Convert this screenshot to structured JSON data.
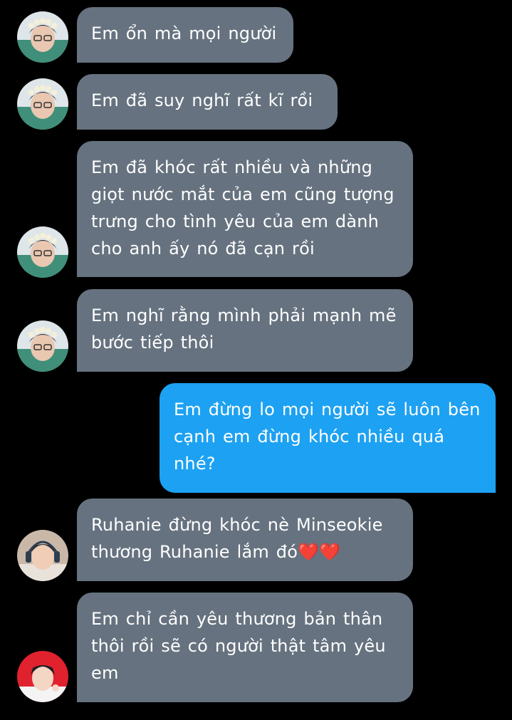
{
  "colors": {
    "background": "#000000",
    "incoming_bubble": "#66727f",
    "outgoing_bubble": "#1da1f2",
    "text": "#ffffff"
  },
  "messages": [
    {
      "sender": "incoming",
      "avatar": "avatar-flower-crown",
      "text": "Em ổn mà mọi người"
    },
    {
      "sender": "incoming",
      "avatar": "avatar-flower-crown",
      "text": "Em đã suy nghĩ rất kĩ rồi"
    },
    {
      "sender": "incoming",
      "avatar": "avatar-flower-crown",
      "text": "Em đã khóc rất nhiều và những giọt nước mắt của em cũng tượng trưng cho tình yêu của em dành cho anh ấy nó đã cạn rồi"
    },
    {
      "sender": "incoming",
      "avatar": "avatar-flower-crown",
      "text": "Em nghĩ rằng mình phải mạnh mẽ bước tiếp thôi"
    },
    {
      "sender": "outgoing",
      "text": "Em đừng lo mọi người sẽ luôn bên cạnh em đừng khóc nhiều quá nhé?"
    },
    {
      "sender": "incoming",
      "avatar": "avatar-headphones",
      "text": "Ruhanie đừng khóc nè Minseokie thương Ruhanie lắm đó❤️❤️"
    },
    {
      "sender": "incoming",
      "avatar": "avatar-red-background",
      "text": "Em chỉ cần yêu thương bản thân thôi rồi sẽ có người thật tâm yêu em"
    }
  ]
}
